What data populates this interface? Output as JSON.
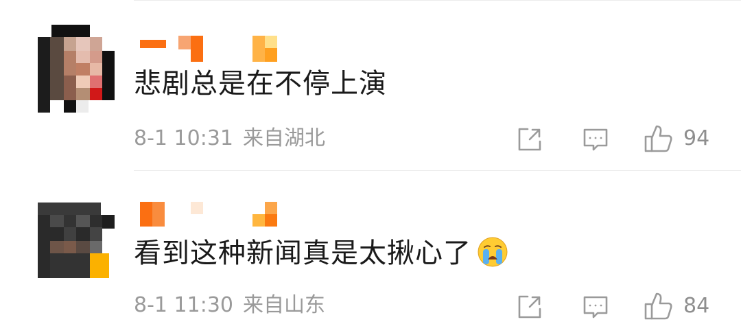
{
  "comments": [
    {
      "text": "悲剧总是在不停上演",
      "time": "8-1 10:31",
      "location": "来自湖北",
      "like_count": "94"
    },
    {
      "text": "看到这种新闻真是太揪心了",
      "emoji": "crying-face-emoji",
      "time": "8-1 11:30",
      "location": "来自山东",
      "like_count": "84"
    }
  ],
  "icons": {
    "share": "share-icon",
    "reply": "comment-icon",
    "like": "thumbs-up-icon"
  },
  "colors": {
    "username_orange": "#fb6f12",
    "text": "#1a1a1a",
    "meta": "#9a9a9a"
  }
}
